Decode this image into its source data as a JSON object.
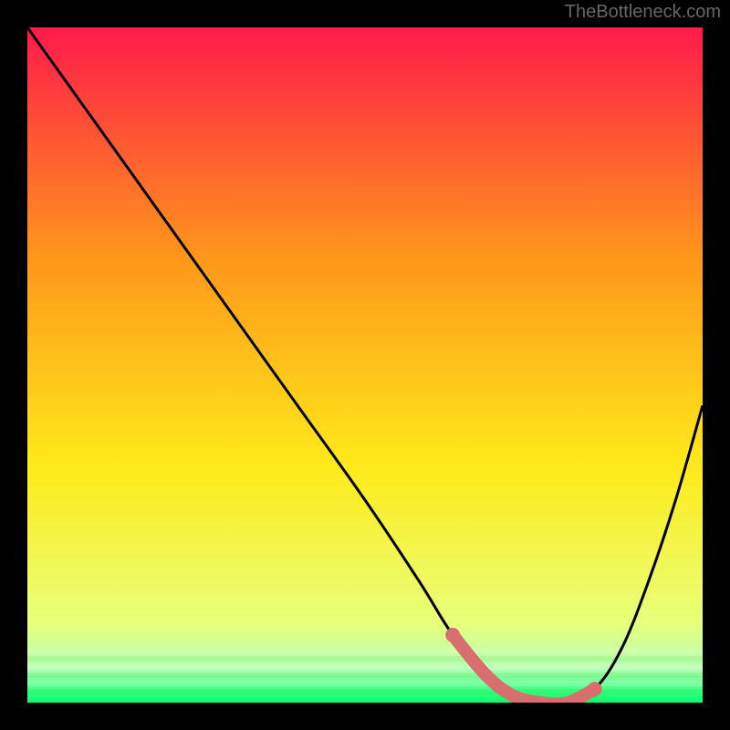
{
  "watermark": "TheBottleneck.com",
  "chart_data": {
    "type": "line",
    "title": "",
    "xlabel": "",
    "ylabel": "",
    "xlim": [
      0,
      100
    ],
    "ylim": [
      0,
      100
    ],
    "gradient_stops": [
      {
        "offset": 0,
        "color": "#ff1a4a"
      },
      {
        "offset": 35,
        "color": "#ff9a1a"
      },
      {
        "offset": 65,
        "color": "#ffea1a"
      },
      {
        "offset": 88,
        "color": "#e8ff7a"
      },
      {
        "offset": 95,
        "color": "#b5ffb5"
      },
      {
        "offset": 100,
        "color": "#00ff6a"
      }
    ],
    "series": [
      {
        "name": "bottleneck-curve",
        "color": "#000000",
        "x": [
          0,
          10,
          20,
          30,
          40,
          50,
          58,
          63,
          68,
          72,
          76,
          80,
          84,
          88,
          92,
          96,
          100
        ],
        "y": [
          100,
          86,
          72,
          58,
          44,
          30,
          18,
          10,
          4,
          1,
          0,
          0,
          2,
          8,
          18,
          30,
          44
        ]
      }
    ],
    "highlight_segment": {
      "color": "#d86e6e",
      "x": [
        63,
        68,
        72,
        76,
        80,
        84
      ],
      "y": [
        10,
        4,
        1,
        0,
        0,
        2
      ]
    }
  }
}
